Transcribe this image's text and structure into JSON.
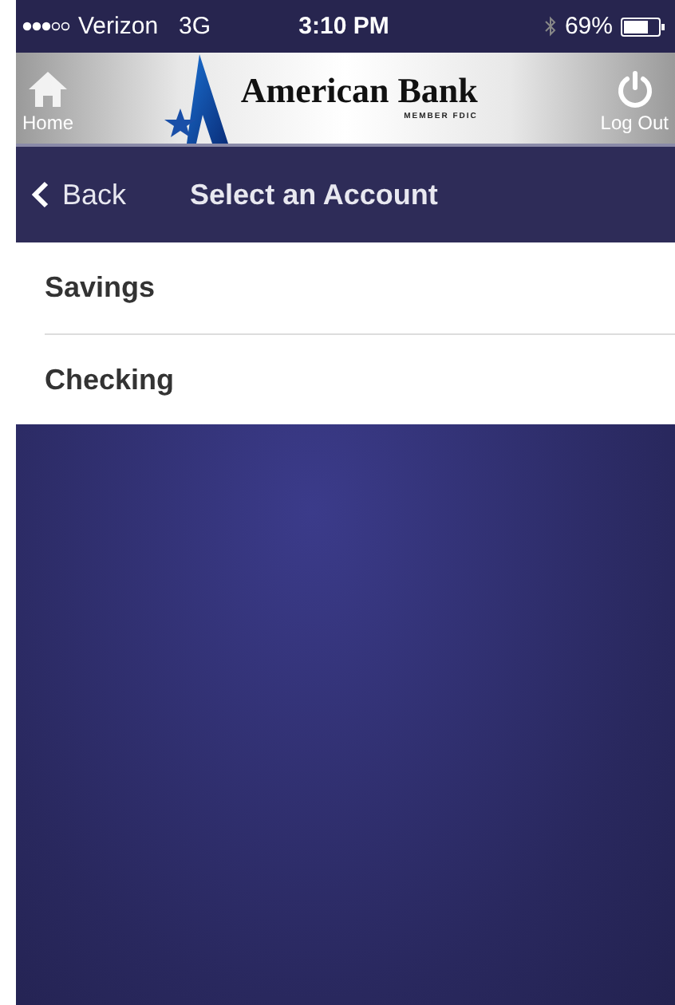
{
  "status_bar": {
    "carrier": "Verizon",
    "network": "3G",
    "time": "3:10 PM",
    "battery": "69%"
  },
  "header": {
    "home_label": "Home",
    "brand": "American Bank",
    "brand_sub": "MEMBER FDIC",
    "logout_label": "Log Out"
  },
  "nav": {
    "back": "Back",
    "title": "Select an Account"
  },
  "accounts": [
    {
      "name": "Savings"
    },
    {
      "name": "Checking"
    }
  ]
}
